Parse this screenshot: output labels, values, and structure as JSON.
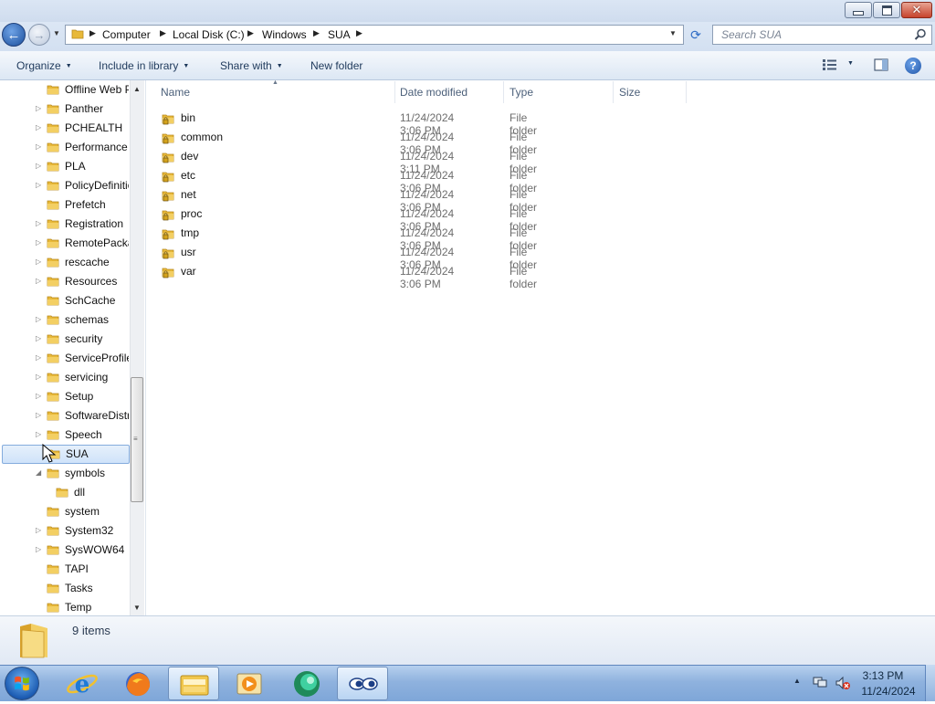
{
  "window": {
    "buttons": {
      "minimize": "minimize",
      "maximize": "maximize",
      "close": "close"
    }
  },
  "address": {
    "breadcrumbs": [
      "Computer",
      "Local Disk (C:)",
      "Windows",
      "SUA"
    ],
    "search_placeholder": "Search SUA"
  },
  "commands": {
    "organize": "Organize",
    "include_in_library": "Include in library",
    "share_with": "Share with",
    "new_folder": "New folder"
  },
  "nav_tree": {
    "items": [
      {
        "label": "Offline Web Pages",
        "expandable": false
      },
      {
        "label": "Panther",
        "expandable": true
      },
      {
        "label": "PCHEALTH",
        "expandable": true
      },
      {
        "label": "Performance",
        "expandable": true
      },
      {
        "label": "PLA",
        "expandable": true
      },
      {
        "label": "PolicyDefinitions",
        "expandable": true
      },
      {
        "label": "Prefetch",
        "expandable": false
      },
      {
        "label": "Registration",
        "expandable": true
      },
      {
        "label": "RemotePackages",
        "expandable": true
      },
      {
        "label": "rescache",
        "expandable": true
      },
      {
        "label": "Resources",
        "expandable": true
      },
      {
        "label": "SchCache",
        "expandable": false
      },
      {
        "label": "schemas",
        "expandable": true
      },
      {
        "label": "security",
        "expandable": true
      },
      {
        "label": "ServiceProfiles",
        "expandable": true
      },
      {
        "label": "servicing",
        "expandable": true
      },
      {
        "label": "Setup",
        "expandable": true
      },
      {
        "label": "SoftwareDistribution",
        "expandable": true
      },
      {
        "label": "Speech",
        "expandable": true
      },
      {
        "label": "SUA",
        "expandable": false,
        "selected": true
      },
      {
        "label": "symbols",
        "expandable": true,
        "expanded": true
      },
      {
        "label": "dll",
        "expandable": false,
        "child": true
      },
      {
        "label": "system",
        "expandable": false
      },
      {
        "label": "System32",
        "expandable": true
      },
      {
        "label": "SysWOW64",
        "expandable": true
      },
      {
        "label": "TAPI",
        "expandable": false
      },
      {
        "label": "Tasks",
        "expandable": false
      },
      {
        "label": "Temp",
        "expandable": false
      }
    ]
  },
  "columns": {
    "name": "Name",
    "date_modified": "Date modified",
    "type": "Type",
    "size": "Size"
  },
  "files": [
    {
      "name": "bin",
      "date": "11/24/2024 3:06 PM",
      "type": "File folder"
    },
    {
      "name": "common",
      "date": "11/24/2024 3:06 PM",
      "type": "File folder"
    },
    {
      "name": "dev",
      "date": "11/24/2024 3:11 PM",
      "type": "File folder"
    },
    {
      "name": "etc",
      "date": "11/24/2024 3:06 PM",
      "type": "File folder"
    },
    {
      "name": "net",
      "date": "11/24/2024 3:06 PM",
      "type": "File folder"
    },
    {
      "name": "proc",
      "date": "11/24/2024 3:06 PM",
      "type": "File folder"
    },
    {
      "name": "tmp",
      "date": "11/24/2024 3:06 PM",
      "type": "File folder"
    },
    {
      "name": "usr",
      "date": "11/24/2024 3:06 PM",
      "type": "File folder"
    },
    {
      "name": "var",
      "date": "11/24/2024 3:06 PM",
      "type": "File folder"
    }
  ],
  "status": {
    "items_count": "9 items"
  },
  "taskbar": {
    "apps": [
      "internet-explorer-icon",
      "firefox-icon",
      "windows-explorer-icon",
      "media-player-icon",
      "app-globe-icon",
      "app-eyes-icon"
    ],
    "clock_time": "3:13 PM",
    "clock_date": "11/24/2024"
  },
  "colors": {
    "folder": "#e8b93a",
    "selection": "#cfe3fa",
    "taskbar": "#8fb2de"
  }
}
